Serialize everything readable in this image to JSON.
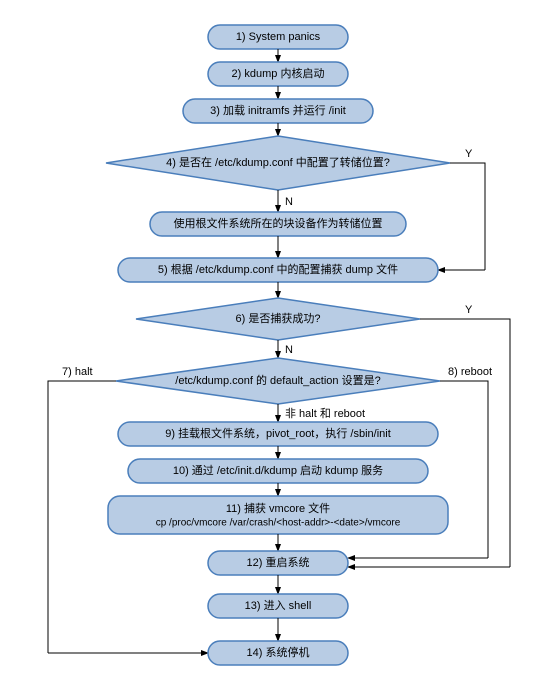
{
  "chart_data": {
    "type": "flowchart",
    "nodes": [
      {
        "id": "n1",
        "shape": "rect",
        "text": "1) System panics"
      },
      {
        "id": "n2",
        "shape": "rect",
        "text": "2) kdump 内核启动"
      },
      {
        "id": "n3",
        "shape": "rect",
        "text": "3)  加载 initramfs 并运行 /init"
      },
      {
        "id": "n4",
        "shape": "diamond",
        "text": "4)  是否在 /etc/kdump.conf 中配置了转储位置?"
      },
      {
        "id": "n4b",
        "shape": "rect",
        "text": "使用根文件系统所在的块设备作为转储位置"
      },
      {
        "id": "n5",
        "shape": "rect",
        "text": "5)  根据 /etc/kdump.conf 中的配置捕获 dump 文件"
      },
      {
        "id": "n6",
        "shape": "diamond",
        "text": "6)  是否捕获成功?"
      },
      {
        "id": "n7",
        "shape": "diamond",
        "text": "/etc/kdump.conf 的 default_action 设置是?"
      },
      {
        "id": "n9",
        "shape": "rect",
        "text": "9)  挂载根文件系统，pivot_root，执行 /sbin/init"
      },
      {
        "id": "n10",
        "shape": "rect",
        "text": "10)  通过 /etc/init.d/kdump 启动 kdump 服务"
      },
      {
        "id": "n11",
        "shape": "rect",
        "text": "11)  捕获 vmcore 文件"
      },
      {
        "id": "n11b",
        "shape": "",
        "text": "cp /proc/vmcore /var/crash/<host-addr>-<date>/vmcore"
      },
      {
        "id": "n12",
        "shape": "rect",
        "text": "12)  重启系统"
      },
      {
        "id": "n13",
        "shape": "rect",
        "text": "13)  进入 shell"
      },
      {
        "id": "n14",
        "shape": "rect",
        "text": "14)  系统停机"
      }
    ],
    "edge_labels": {
      "yes": "Y",
      "no": "N",
      "halt": "7) halt",
      "reboot": "8) reboot",
      "neither": "非 halt 和 reboot"
    },
    "edges": [
      {
        "from": "n1",
        "to": "n2"
      },
      {
        "from": "n2",
        "to": "n3"
      },
      {
        "from": "n3",
        "to": "n4"
      },
      {
        "from": "n4",
        "to": "n4b",
        "label": "N"
      },
      {
        "from": "n4",
        "to": "n5",
        "label": "Y",
        "route": "right-down"
      },
      {
        "from": "n4b",
        "to": "n5"
      },
      {
        "from": "n5",
        "to": "n6"
      },
      {
        "from": "n6",
        "to": "n7",
        "label": "N"
      },
      {
        "from": "n6",
        "to": "n12",
        "label": "Y",
        "route": "right-down"
      },
      {
        "from": "n7",
        "to": "n9",
        "label": "非 halt 和 reboot"
      },
      {
        "from": "n7",
        "to": "n14",
        "label": "7) halt",
        "route": "left-down"
      },
      {
        "from": "n7",
        "to": "n12",
        "label": "8) reboot",
        "route": "right-down"
      },
      {
        "from": "n9",
        "to": "n10"
      },
      {
        "from": "n10",
        "to": "n11"
      },
      {
        "from": "n11",
        "to": "n12"
      },
      {
        "from": "n12",
        "to": "n13"
      },
      {
        "from": "n13",
        "to": "n14"
      }
    ]
  }
}
